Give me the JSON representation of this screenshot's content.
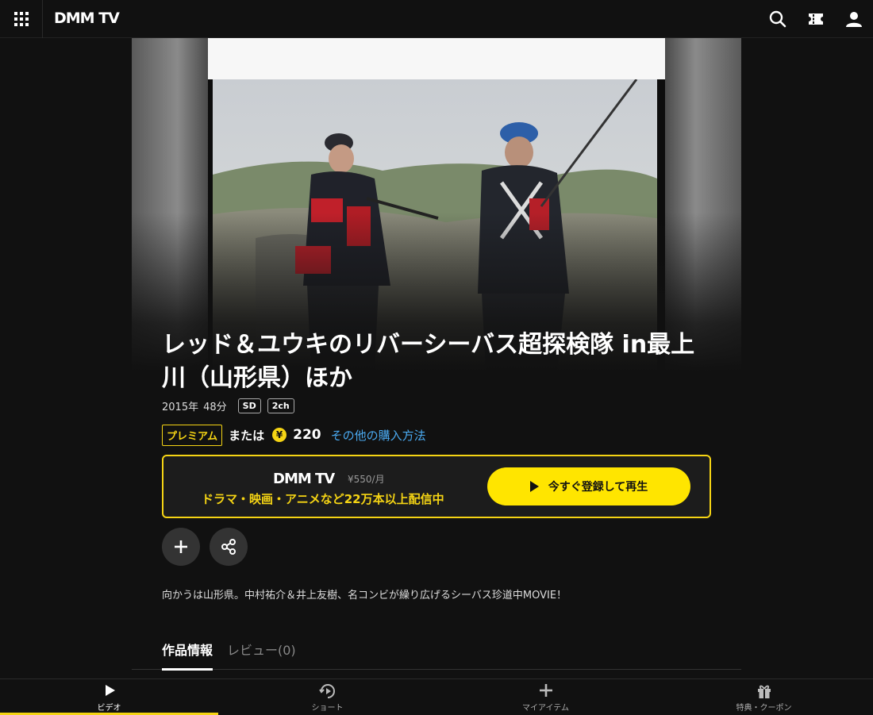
{
  "header": {
    "logo": "DMM TV"
  },
  "title": "レッド＆ユウキのリバーシーバス超探検隊 in最上川（山形県）ほか",
  "meta": {
    "year": "2015年",
    "duration": "48分",
    "quality": "SD",
    "audio": "2ch"
  },
  "purchase": {
    "premium_label": "プレミアム",
    "or_text": "または",
    "yen_symbol": "¥",
    "price": "220",
    "other_methods": "その他の購入方法"
  },
  "promo": {
    "logo": "DMM TV",
    "monthly_price": "¥550/月",
    "description": "ドラマ・映画・アニメなど22万本以上配信中",
    "cta": "今すぐ登録して再生"
  },
  "description": "向かうは山形県。中村祐介＆井上友樹、名コンビが繰り広げるシーバス珍道中MOVIE！",
  "tabs": [
    {
      "label": "作品情報",
      "active": true
    },
    {
      "label": "レビュー(0)",
      "active": false
    }
  ],
  "bottom_nav": [
    {
      "label": "ビデオ",
      "icon": "play-icon",
      "active": true
    },
    {
      "label": "ショート",
      "icon": "short-video-icon",
      "active": false
    },
    {
      "label": "マイアイテム",
      "icon": "plus-icon",
      "active": false
    },
    {
      "label": "特典・クーポン",
      "icon": "gift-icon",
      "active": false
    }
  ],
  "colors": {
    "accent": "#f5d414",
    "link": "#4aa9f0",
    "background": "#111111"
  }
}
